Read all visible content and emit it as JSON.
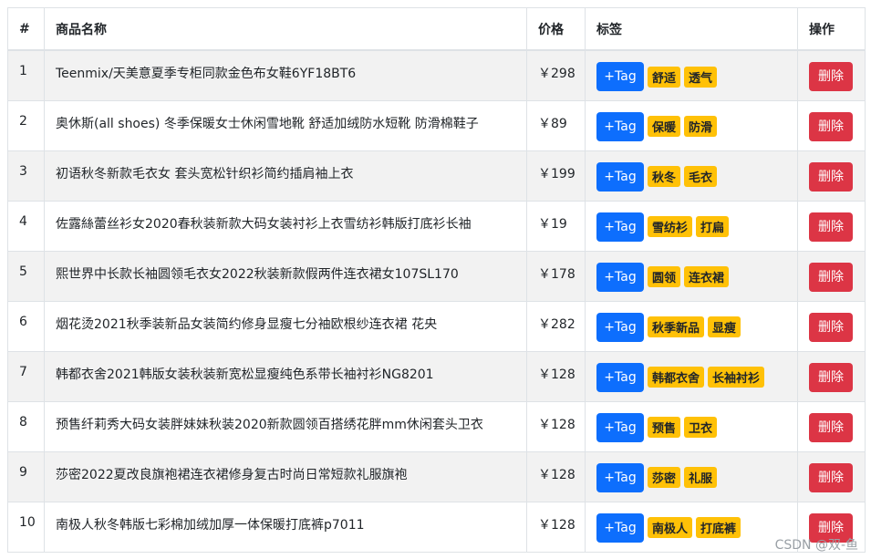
{
  "table": {
    "headers": {
      "index": "#",
      "name": "商品名称",
      "price": "价格",
      "tags": "标签",
      "actions": "操作"
    },
    "add_tag_label": "+Tag",
    "delete_label": "删除",
    "rows": [
      {
        "index": "1",
        "name": "Teenmix/天美意夏季专柜同款金色布女鞋6YF18BT6",
        "price": "￥298",
        "tags": [
          "舒适",
          "透气"
        ]
      },
      {
        "index": "2",
        "name": "奥休斯(all shoes) 冬季保暖女士休闲雪地靴 舒适加绒防水短靴 防滑棉鞋子",
        "price": "￥89",
        "tags": [
          "保暖",
          "防滑"
        ]
      },
      {
        "index": "3",
        "name": "初语秋冬新款毛衣女 套头宽松针织衫简约插肩袖上衣",
        "price": "￥199",
        "tags": [
          "秋冬",
          "毛衣"
        ]
      },
      {
        "index": "4",
        "name": "佐露絲蕾丝衫女2020春秋装新款大码女装衬衫上衣雪纺衫韩版打底衫长袖",
        "price": "￥19",
        "tags": [
          "雪纺衫",
          "打扁"
        ]
      },
      {
        "index": "5",
        "name": "熙世界中长款长袖圆领毛衣女2022秋装新款假两件连衣裙女107SL170",
        "price": "￥178",
        "tags": [
          "圆领",
          "连衣裙"
        ]
      },
      {
        "index": "6",
        "name": "烟花烫2021秋季装新品女装简约修身显瘦七分袖欧根纱连衣裙 花央",
        "price": "￥282",
        "tags": [
          "秋季新品",
          "显瘦"
        ]
      },
      {
        "index": "7",
        "name": "韩都衣舍2021韩版女装秋装新宽松显瘦纯色系带长袖衬衫NG8201",
        "price": "￥128",
        "tags": [
          "韩都衣舍",
          "长袖衬衫"
        ]
      },
      {
        "index": "8",
        "name": "预售纤莉秀大码女装胖妹妹秋装2020新款圆领百搭绣花胖mm休闲套头卫衣",
        "price": "￥128",
        "tags": [
          "预售",
          "卫衣"
        ]
      },
      {
        "index": "9",
        "name": "莎密2022夏改良旗袍裙连衣裙修身复古时尚日常短款礼服旗袍",
        "price": "￥128",
        "tags": [
          "莎密",
          "礼服"
        ]
      },
      {
        "index": "10",
        "name": "南极人秋冬韩版七彩棉加绒加厚一体保暖打底裤p7011",
        "price": "￥128",
        "tags": [
          "南极人",
          "打底裤"
        ]
      }
    ]
  },
  "watermark": "CSDN @双-鱼",
  "colors": {
    "primary": "#0d6efd",
    "warning": "#ffc107",
    "danger": "#dc3545",
    "stripe": "#f2f2f2"
  }
}
